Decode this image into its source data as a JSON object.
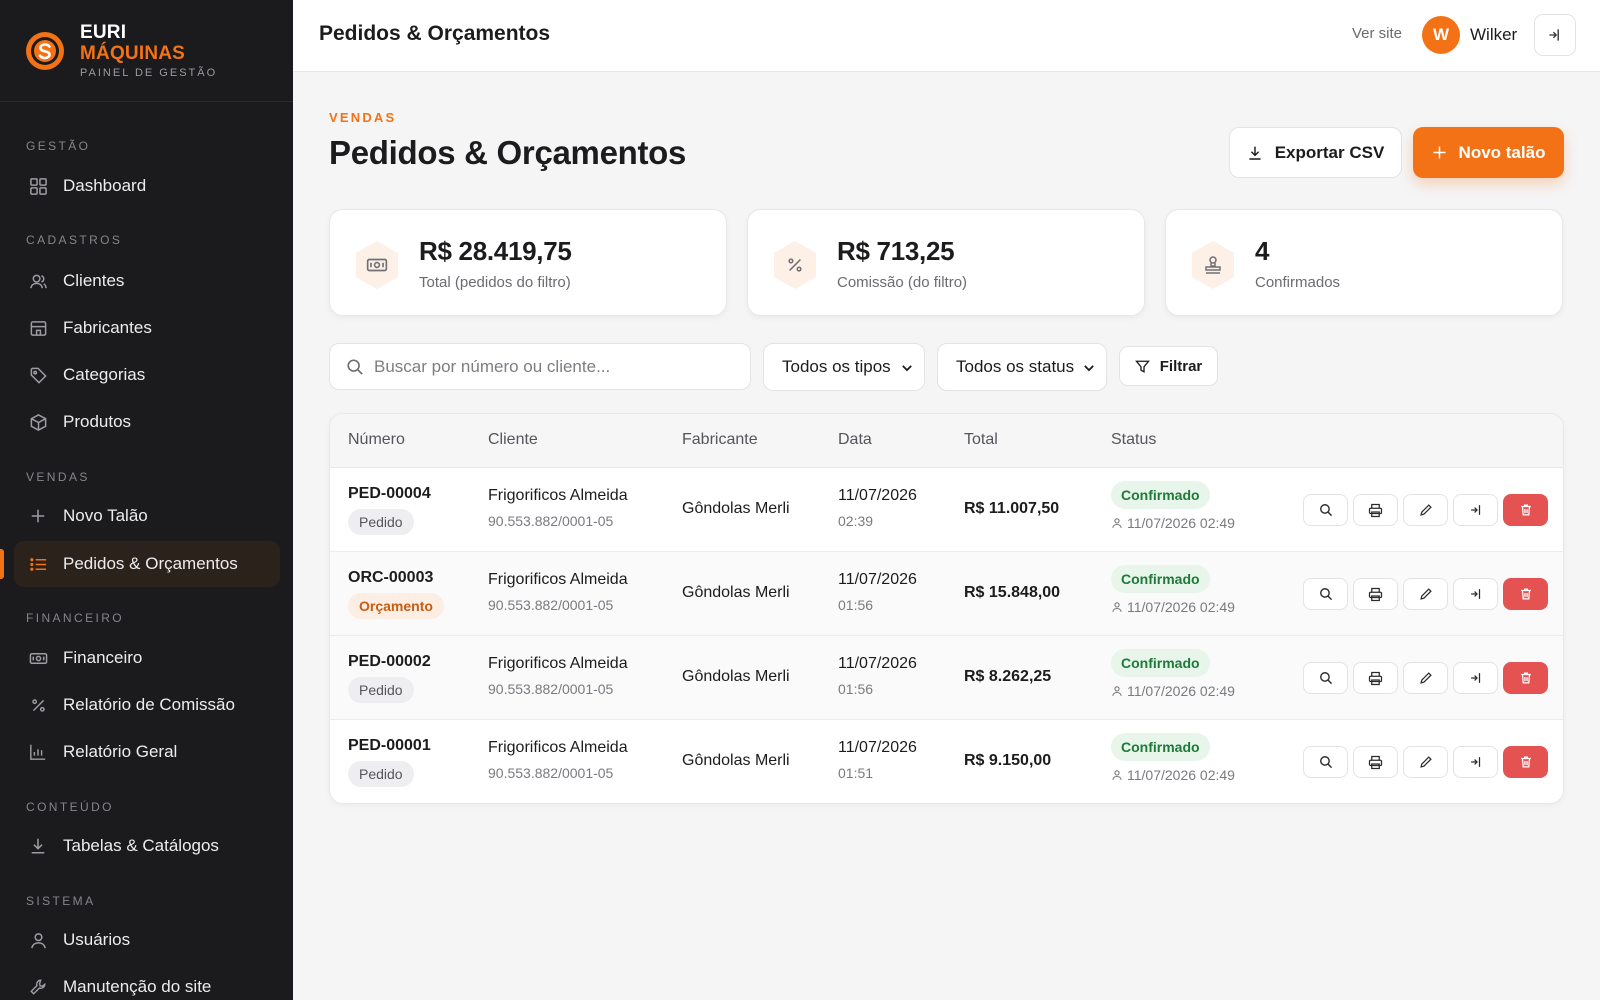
{
  "brand": {
    "line1": "EURI",
    "line2": "MÁQUINAS",
    "line3": "PAINEL DE GESTÃO"
  },
  "sidebar": {
    "sections": {
      "gestao": "GESTÃO",
      "cadastros": "CADASTROS",
      "vendas": "VENDAS",
      "financeiro": "FINANCEIRO",
      "conteudo": "CONTEÚDO",
      "sistema": "SISTEMA"
    },
    "items": {
      "dashboard": "Dashboard",
      "clientes": "Clientes",
      "fabricantes": "Fabricantes",
      "categorias": "Categorias",
      "produtos": "Produtos",
      "novo_talao": "Novo Talão",
      "pedidos": "Pedidos & Orçamentos",
      "financeiro": "Financeiro",
      "comissao": "Relatório de Comissão",
      "geral": "Relatório Geral",
      "tabelas": "Tabelas & Catálogos",
      "usuarios": "Usuários",
      "manutencao": "Manutenção do site"
    }
  },
  "topbar": {
    "title": "Pedidos & Orçamentos",
    "ver_site": "Ver site",
    "avatar_initial": "W",
    "user_name": "Wilker"
  },
  "header": {
    "eyebrow": "VENDAS",
    "title": "Pedidos & Orçamentos",
    "export_label": "Exportar CSV",
    "new_label": "Novo talão"
  },
  "stats": [
    {
      "value": "R$ 28.419,75",
      "label": "Total (pedidos do filtro)",
      "icon": "cash-icon"
    },
    {
      "value": "R$ 713,25",
      "label": "Comissão (do filtro)",
      "icon": "percent-icon"
    },
    {
      "value": "4",
      "label": "Confirmados",
      "icon": "stamp-icon"
    }
  ],
  "filters": {
    "search_placeholder": "Buscar por número ou cliente...",
    "tipo_selected": "Todos os tipos",
    "status_selected": "Todos os status",
    "filter_label": "Filtrar"
  },
  "table": {
    "headers": [
      "Número",
      "Cliente",
      "Fabricante",
      "Data",
      "Total",
      "Status"
    ],
    "rows": [
      {
        "numero": "PED-00004",
        "tipo": "Pedido",
        "cliente": "Frigorificos Almeida",
        "doc": "90.553.882/0001-05",
        "fabricante": "Gôndolas Merli",
        "data": "11/07/2026",
        "hora": "02:39",
        "total": "R$ 11.007,50",
        "status": "Confirmado",
        "status_time": "11/07/2026 02:49"
      },
      {
        "numero": "ORC-00003",
        "tipo": "Orçamento",
        "cliente": "Frigorificos Almeida",
        "doc": "90.553.882/0001-05",
        "fabricante": "Gôndolas Merli",
        "data": "11/07/2026",
        "hora": "01:56",
        "total": "R$ 15.848,00",
        "status": "Confirmado",
        "status_time": "11/07/2026 02:49"
      },
      {
        "numero": "PED-00002",
        "tipo": "Pedido",
        "cliente": "Frigorificos Almeida",
        "doc": "90.553.882/0001-05",
        "fabricante": "Gôndolas Merli",
        "data": "11/07/2026",
        "hora": "01:56",
        "total": "R$ 8.262,25",
        "status": "Confirmado",
        "status_time": "11/07/2026 02:49"
      },
      {
        "numero": "PED-00001",
        "tipo": "Pedido",
        "cliente": "Frigorificos Almeida",
        "doc": "90.553.882/0001-05",
        "fabricante": "Gôndolas Merli",
        "data": "11/07/2026",
        "hora": "01:51",
        "total": "R$ 9.150,00",
        "status": "Confirmado",
        "status_time": "11/07/2026 02:49"
      }
    ]
  },
  "colors": {
    "accent": "#f47216",
    "sidebar_bg": "#1b1b1d",
    "success_bg": "#e7f5ea",
    "success_text": "#1f7a3a",
    "danger": "#e55252"
  }
}
